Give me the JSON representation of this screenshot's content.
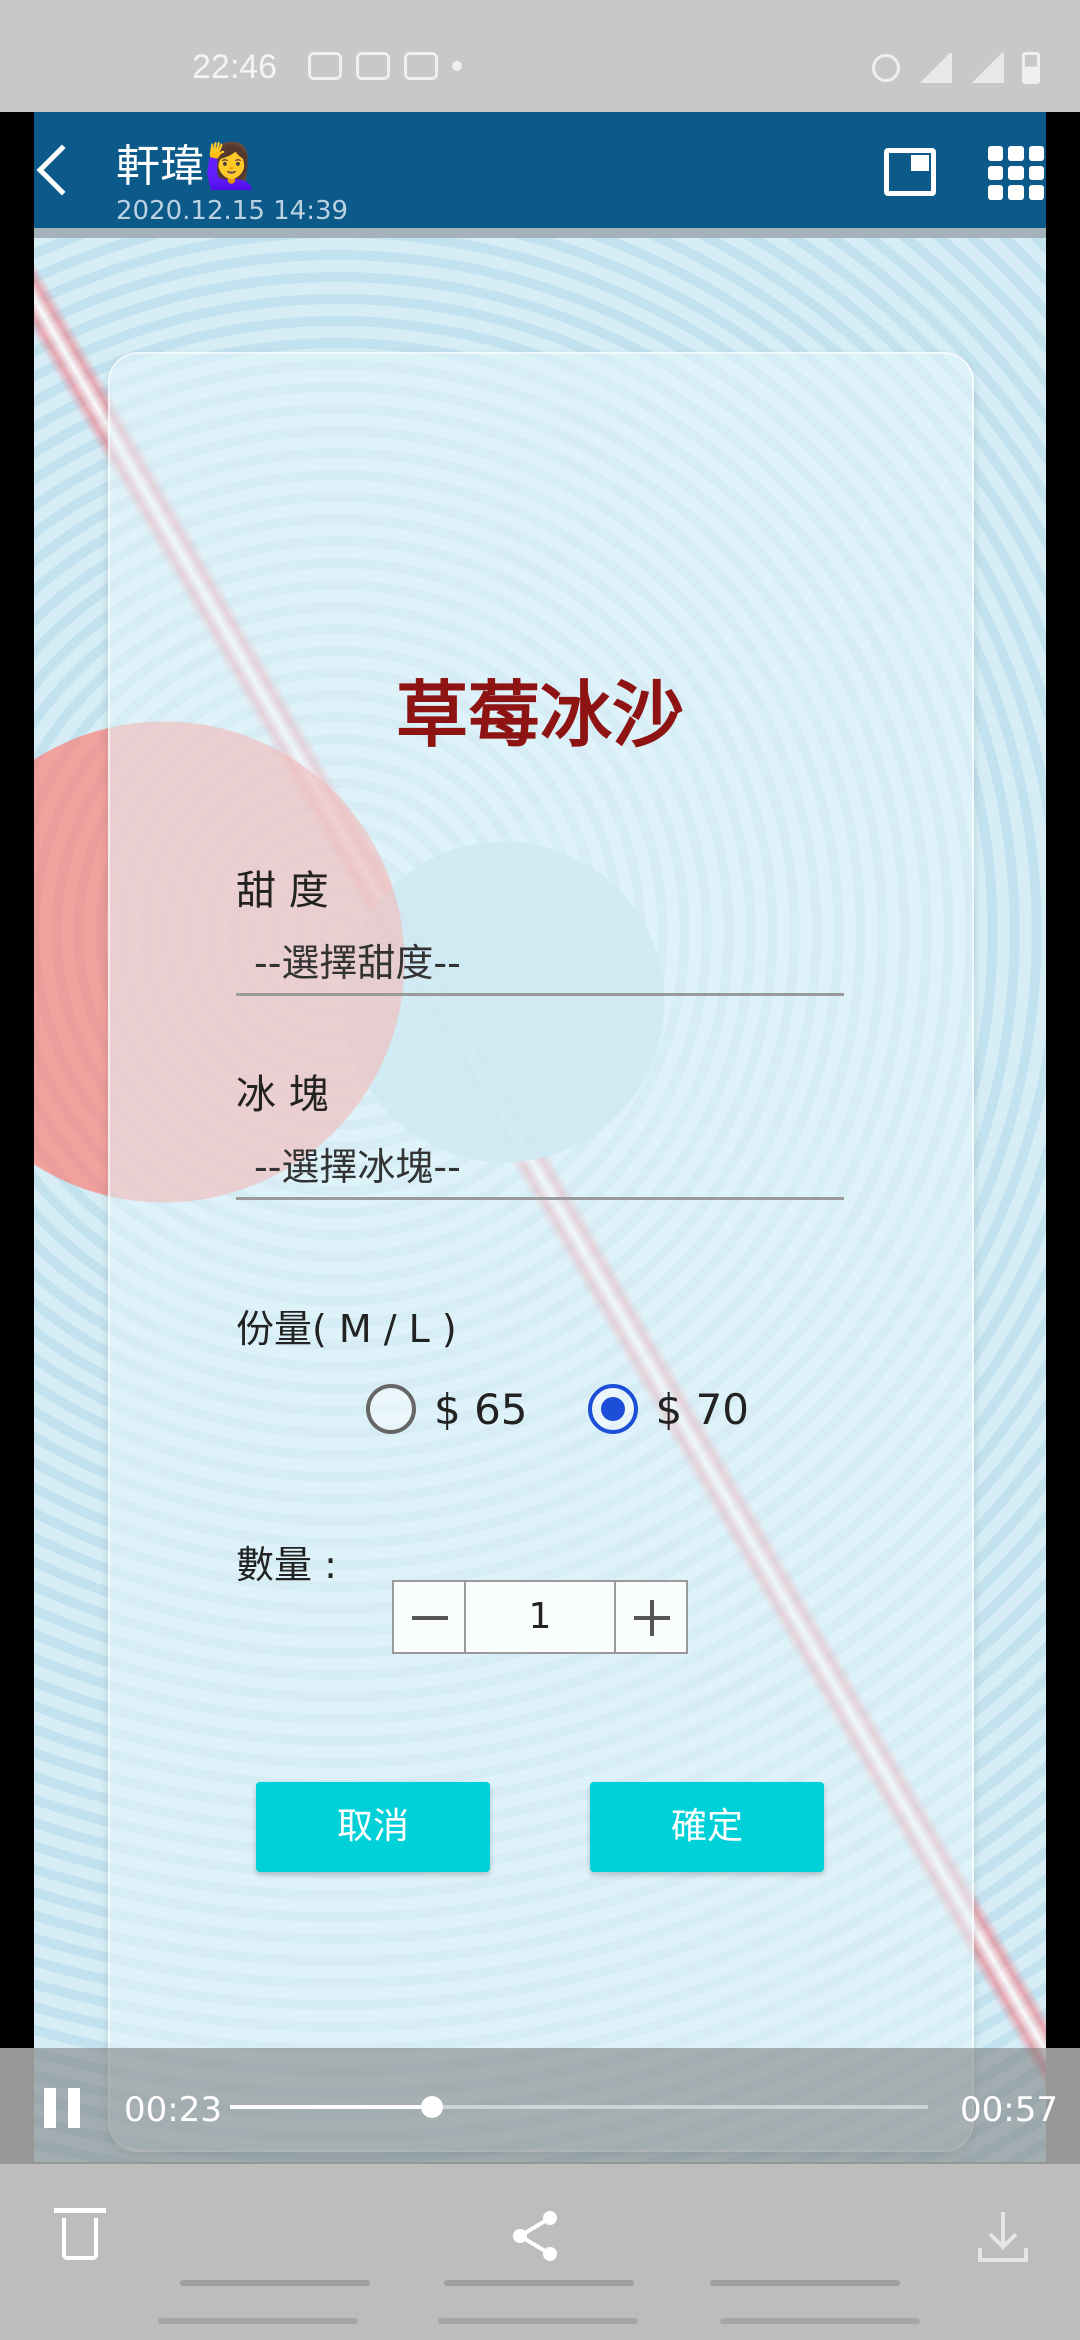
{
  "status_bar": {
    "time": "22:46"
  },
  "header": {
    "sender": "軒瑋🙋‍♀️",
    "timestamp": "2020.12.15 14:39"
  },
  "dialog": {
    "title": "草莓冰沙",
    "sweetness_label": "甜 度",
    "sweetness_value": "--選擇甜度--",
    "ice_label": "冰 塊",
    "ice_value": "--選擇冰塊--",
    "size_label": "份量( M / L )",
    "size_options": [
      {
        "label": "$ 65",
        "checked": false
      },
      {
        "label": "$ 70",
        "checked": true
      }
    ],
    "quantity_label": "數量 :",
    "quantity_value": "1",
    "cancel_label": "取消",
    "confirm_label": "確定"
  },
  "player": {
    "current_time": "00:23",
    "total_time": "00:57",
    "progress_fraction": 0.29
  },
  "colors": {
    "header_bg": "#0c5a8a",
    "title_color": "#8e1414",
    "button_bg": "#00d1d8",
    "radio_checked": "#1d4ed8"
  }
}
